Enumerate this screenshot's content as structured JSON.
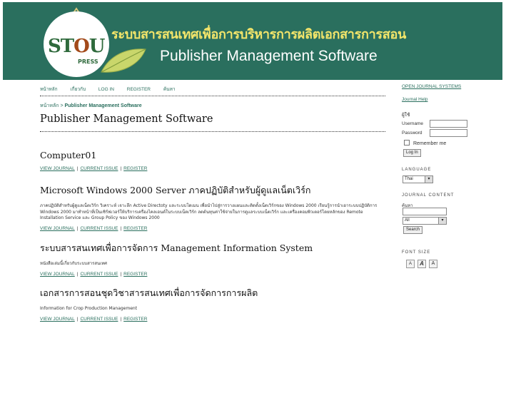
{
  "header": {
    "title_thai": "ระบบสารสนเทศเพื่อการบริหารการผลิตเอกสารการสอน",
    "title_en": "Publisher Management Software",
    "logo_text": "STOU",
    "logo_sub": "PRESS"
  },
  "nav": {
    "items": [
      "หน้าหลัก",
      "เกี่ยวกับ",
      "LOG IN",
      "REGISTER",
      "ค้นหา"
    ]
  },
  "breadcrumb": {
    "home": "หน้าหลัก",
    "sep": ">",
    "current": "Publisher Management Software"
  },
  "page_title": "Publisher Management Software",
  "journals": [
    {
      "title": "Computer01",
      "description": "",
      "view": "VIEW JOURNAL",
      "current": "CURRENT ISSUE",
      "register": "REGISTER"
    },
    {
      "title": "Microsoft Windows 2000 Server ภาคปฏิบัติสำหรับผู้ดูแลเน็ตเวิร์ก",
      "description": "ภาคปฏิบัติสำหรับผู้ดูแลเน็ตเวิร์ก วิเคราะห์ เจาะลึก Active Directoty และระบบโดเมน เพื่อนำไปสู่การวางแผนและติดตั้งเน็ตเวิร์กของ Windows 2000 เรียนรู้การนำเอาระบบปฏิบัติการ Windows 2000 มาทำหน้าที่เป็นเซิร์ฟเวอร์ให้บริการเครื่องไคลเอนต์ในระบบเน็ตเวิร์ก ลดต้นทุนค่าใช้จ่ายในการดูแลระบบเน็ตเวิร์ก และเครื่องคอมพิวเตอร์โดยหลักของ Remote Installation Service และ Group Policy ของ Windows 2000",
      "view": "VIEW JOURNAL",
      "current": "CURRENT ISSUE",
      "register": "REGISTER"
    },
    {
      "title": "ระบบสารสนเทศเพื่อการจัดการ Management Information System",
      "description": "หนังสือเล่มนี้เกี่ยวกับระบบสารสนเทศ",
      "view": "VIEW JOURNAL",
      "current": "CURRENT ISSUE",
      "register": "REGISTER"
    },
    {
      "title": "เอกสารการสอนชุดวิชาสารสนเทศเพื่อการจัดการการผลิต",
      "description": "Information for Crop Production Management",
      "view": "VIEW JOURNAL",
      "current": "CURRENT ISSUE",
      "register": "REGISTER"
    }
  ],
  "sidebar": {
    "ojs_link": "OPEN JOURNAL SYSTEMS",
    "help_link": "Journal Help",
    "user_heading": "ผู้ใช้",
    "username_label": "Username",
    "password_label": "Password",
    "remember_label": "Remember me",
    "login_button": "Log In",
    "language_heading": "LANGUAGE",
    "language_value": "Thai",
    "content_heading": "JOURNAL CONTENT",
    "search_label": "ค้นหา",
    "search_scope": "All",
    "search_button": "Search",
    "fontsize_heading": "FONT SIZE",
    "font_small": "A",
    "font_medium": "A",
    "font_large": "A"
  },
  "colors": {
    "header_bg": "#2a6f5e",
    "title_yellow": "#f3e56a",
    "link_green": "#2a6f5e"
  }
}
